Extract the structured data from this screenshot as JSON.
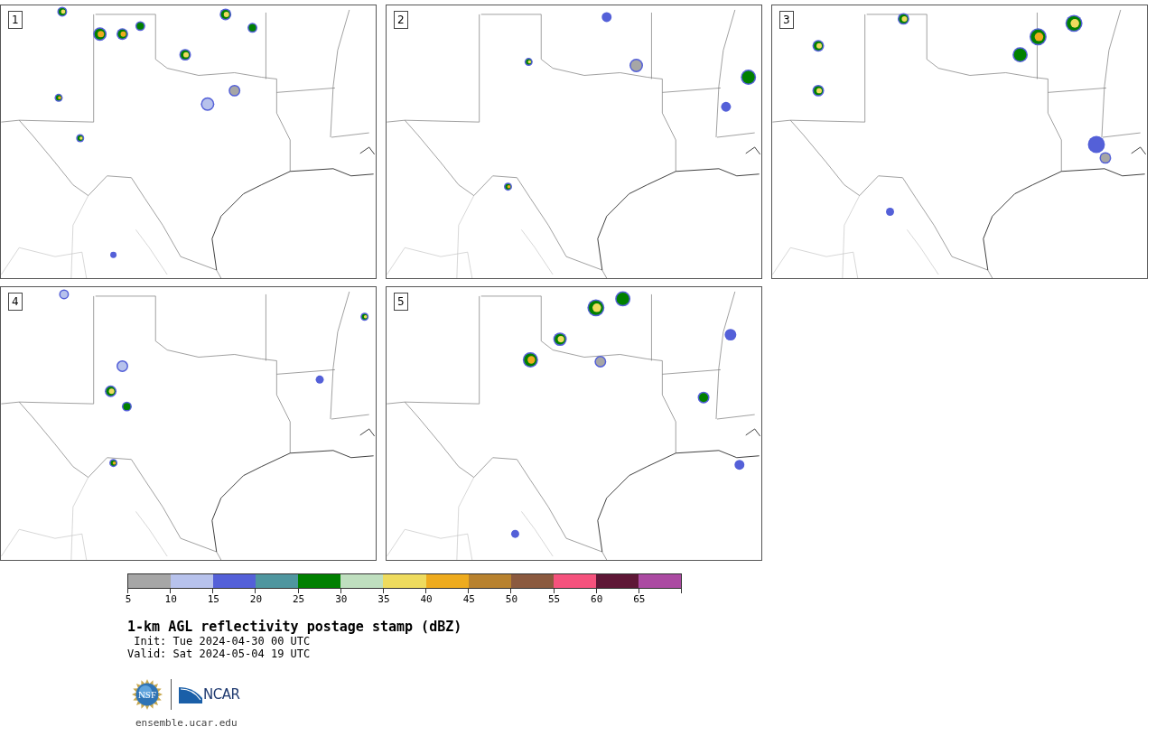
{
  "panels": [
    {
      "label": "1"
    },
    {
      "label": "2"
    },
    {
      "label": "3"
    },
    {
      "label": "4"
    },
    {
      "label": "5"
    }
  ],
  "colorbar": {
    "segments": [
      {
        "color": "#a6a6a6"
      },
      {
        "color": "#b7c2ec"
      },
      {
        "color": "#5460d8"
      },
      {
        "color": "#4f969f"
      },
      {
        "color": "#008000"
      },
      {
        "color": "#bfdfbf"
      },
      {
        "color": "#eedb5e"
      },
      {
        "color": "#eeab1e"
      },
      {
        "color": "#b8822f"
      },
      {
        "color": "#8b5a3f"
      },
      {
        "color": "#f5527d"
      },
      {
        "color": "#5e1736"
      },
      {
        "color": "#ab4aa2"
      }
    ],
    "ticks": [
      "5",
      "10",
      "15",
      "20",
      "25",
      "30",
      "35",
      "40",
      "45",
      "50",
      "55",
      "60",
      "65"
    ]
  },
  "title": "1-km AGL reflectivity postage stamp (dBZ)",
  "init": " Init: Tue 2024-04-30 00 UTC",
  "valid": "Valid: Sat 2024-05-04 19 UTC",
  "logos": {
    "nsf": "NSF",
    "ncar": "NCAR"
  },
  "url": "ensemble.ucar.edu"
}
